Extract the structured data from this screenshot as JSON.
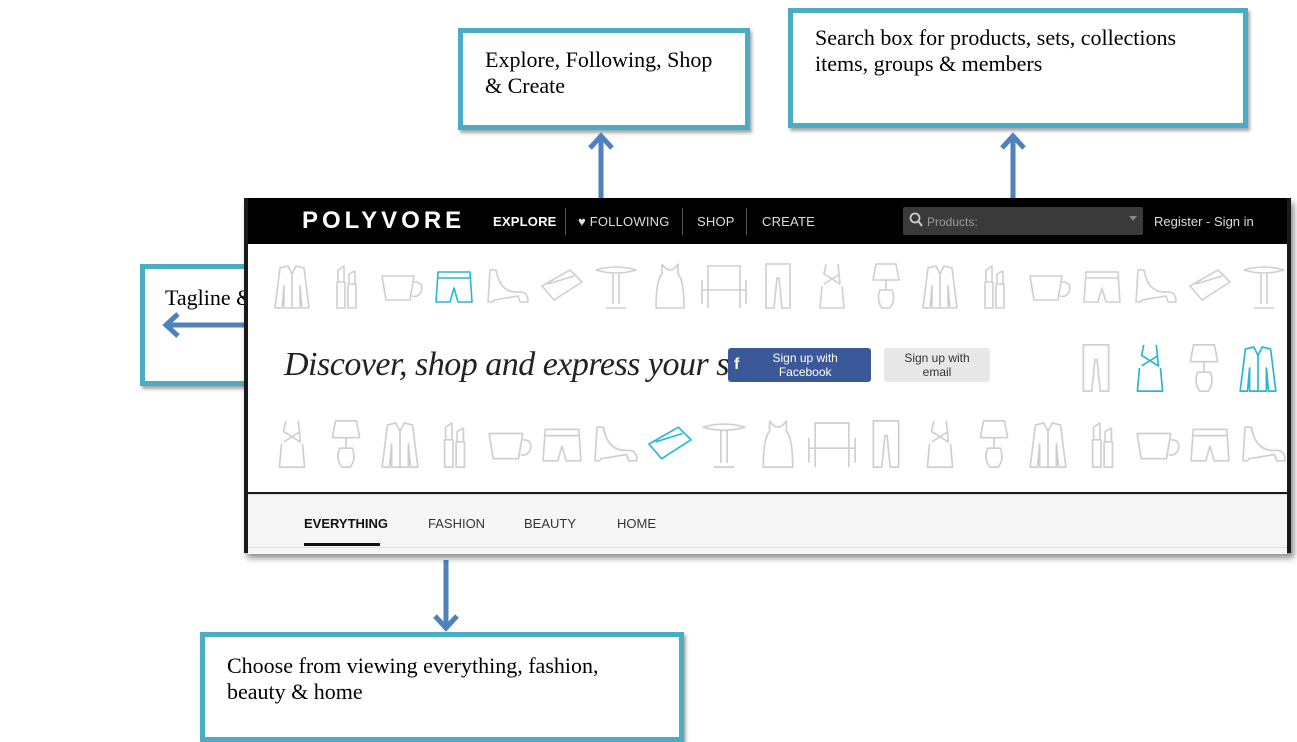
{
  "annotations": {
    "nav": "Explore, Following, Shop & Create",
    "search": "Search box for products, sets, collections items, groups & members",
    "tagline": "Tagline & sign up",
    "categories": "Choose from viewing everything, fashion, beauty & home"
  },
  "site": {
    "logo": "POLYVORE",
    "nav": {
      "explore": "EXPLORE",
      "following": "FOLLOWING",
      "shop": "SHOP",
      "create": "CREATE"
    },
    "search": {
      "placeholder": "Products:"
    },
    "auth": {
      "register": "Register",
      "separator": "-",
      "signin": "Sign in"
    },
    "hero": {
      "tagline": "Discover, shop and express your style",
      "facebook_button": "Sign up with Facebook",
      "facebook_glyph": "f",
      "email_button": "Sign up with email"
    },
    "tabs": {
      "everything": "EVERYTHING",
      "fashion": "FASHION",
      "beauty": "BEAUTY",
      "home": "HOME"
    }
  },
  "colors": {
    "callout_border": "#4bacc6",
    "arrow": "#4f81bd",
    "highlight_icon": "#29b6d6",
    "facebook": "#3b5998"
  }
}
